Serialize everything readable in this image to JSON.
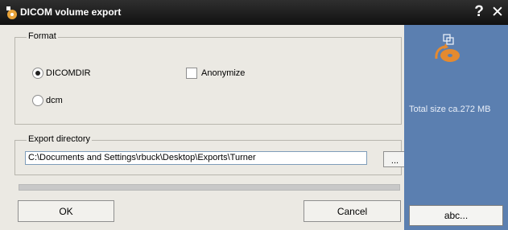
{
  "window": {
    "title": "DICOM volume export",
    "help_label": "?",
    "close_label": "✕"
  },
  "format": {
    "group_label": "Format",
    "options": [
      {
        "label": "DICOMDIR",
        "selected": true
      },
      {
        "label": "dcm",
        "selected": false
      }
    ],
    "anonymize": {
      "label": "Anonymize",
      "checked": false
    }
  },
  "export_directory": {
    "group_label": "Export directory",
    "path": "C:\\Documents and Settings\\rbuck\\Desktop\\Exports\\Turner",
    "browse_label": "..."
  },
  "buttons": {
    "ok_label": "OK",
    "cancel_label": "Cancel",
    "abc_label": "abc..."
  },
  "side_panel": {
    "total_size": "Total size ca.272 MB"
  },
  "progress": {
    "fraction": 0
  },
  "colors": {
    "titlebar": "#111111",
    "side_panel": "#5b7fb0",
    "dialog_bg": "#ebe9e3",
    "accent_orange": "#e58a2f"
  },
  "icons": [
    "dicom-app-icon",
    "help-icon",
    "close-icon",
    "disc-export-icon"
  ]
}
